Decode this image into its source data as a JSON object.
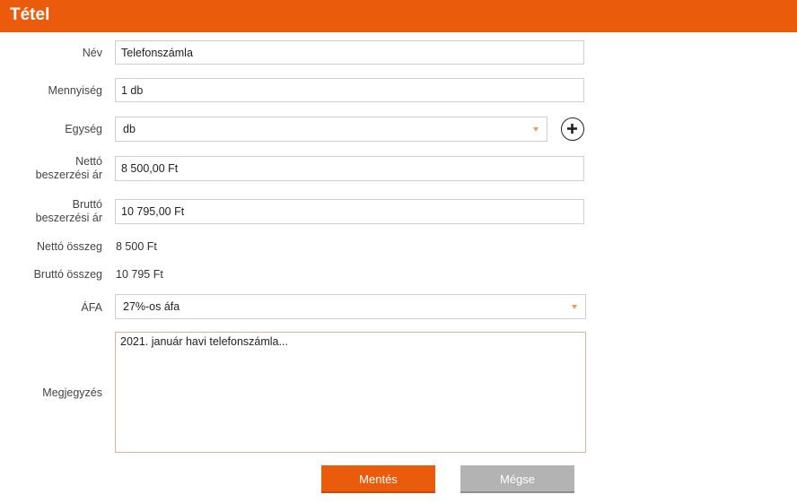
{
  "header": {
    "title": "Tétel"
  },
  "form": {
    "name": {
      "label": "Név",
      "value": "Telefonszámla"
    },
    "quantity": {
      "label": "Mennyiség",
      "value": "1 db"
    },
    "unit": {
      "label": "Egység",
      "value": "db"
    },
    "net_purchase_price": {
      "label_line1": "Nettó",
      "label_line2": "beszerzési ár",
      "value": "8 500,00 Ft"
    },
    "gross_purchase_price": {
      "label_line1": "Bruttó",
      "label_line2": "beszerzési ár",
      "value": "10 795,00 Ft"
    },
    "net_total": {
      "label": "Nettó összeg",
      "value": "8 500 Ft"
    },
    "gross_total": {
      "label": "Bruttó összeg",
      "value": "10 795 Ft"
    },
    "vat": {
      "label": "ÁFA",
      "value": "27%-os áfa"
    },
    "note": {
      "label": "Megjegyzés",
      "value": "2021. január havi telefonszámla..."
    }
  },
  "actions": {
    "save_label": "Mentés",
    "cancel_label": "Mégse"
  },
  "colors": {
    "accent": "#ea5b0c",
    "cancel": "#b3b3b3"
  },
  "icons": {
    "add_unit": "plus-circle-icon",
    "dropdown": "caret-down-icon"
  }
}
